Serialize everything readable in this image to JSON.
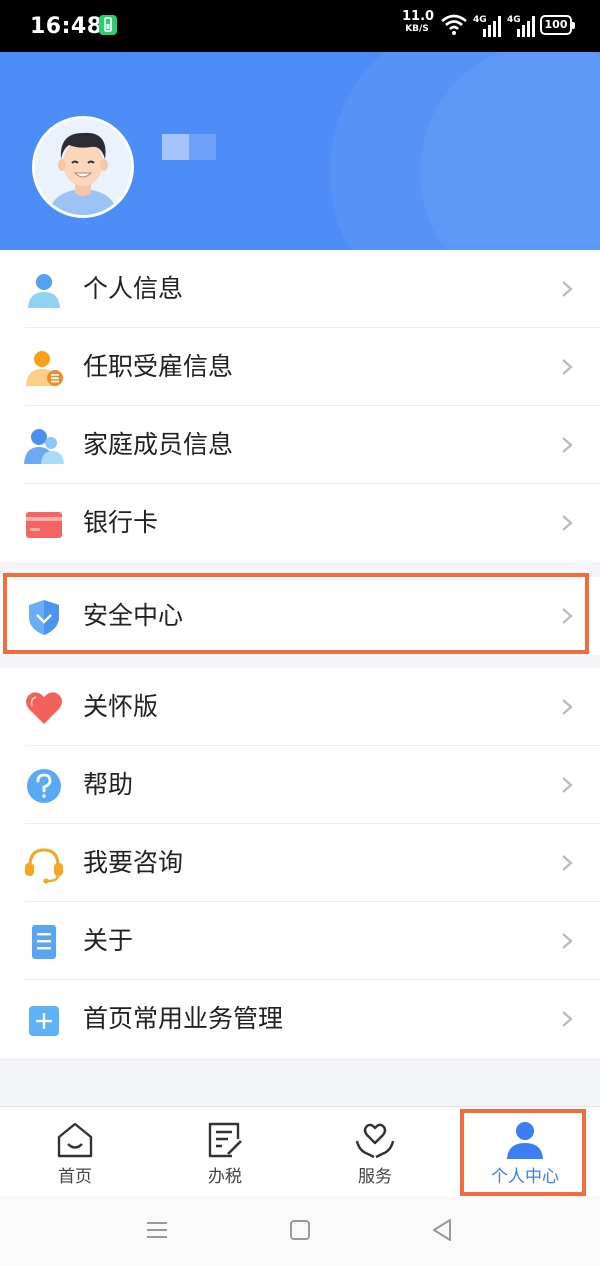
{
  "status_bar": {
    "time": "16:48",
    "net_speed_value": "11.0",
    "net_speed_unit": "KB/S",
    "network_1": "4G",
    "network_2": "4G",
    "battery": "100"
  },
  "profile": {
    "avatar_icon": "user-avatar-icon"
  },
  "menu_group_1": [
    {
      "label": "个人信息",
      "icon": "person-icon"
    },
    {
      "label": "任职受雇信息",
      "icon": "employment-icon"
    },
    {
      "label": "家庭成员信息",
      "icon": "family-icon"
    },
    {
      "label": "银行卡",
      "icon": "bank-card-icon"
    }
  ],
  "menu_group_2": [
    {
      "label": "安全中心",
      "icon": "shield-icon"
    }
  ],
  "menu_group_3": [
    {
      "label": "关怀版",
      "icon": "heart-icon"
    },
    {
      "label": "帮助",
      "icon": "help-icon"
    },
    {
      "label": "我要咨询",
      "icon": "headset-icon"
    },
    {
      "label": "关于",
      "icon": "document-icon"
    },
    {
      "label": "首页常用业务管理",
      "icon": "add-icon"
    }
  ],
  "bottom_nav": [
    {
      "label": "首页",
      "icon": "home-icon"
    },
    {
      "label": "办税",
      "icon": "tax-icon"
    },
    {
      "label": "服务",
      "icon": "service-icon"
    },
    {
      "label": "个人中心",
      "icon": "person-icon",
      "active": true
    }
  ],
  "colors": {
    "brand_blue": "#4c8df7",
    "highlight": "#f26c3d",
    "active_tab": "#3d7ff3"
  }
}
